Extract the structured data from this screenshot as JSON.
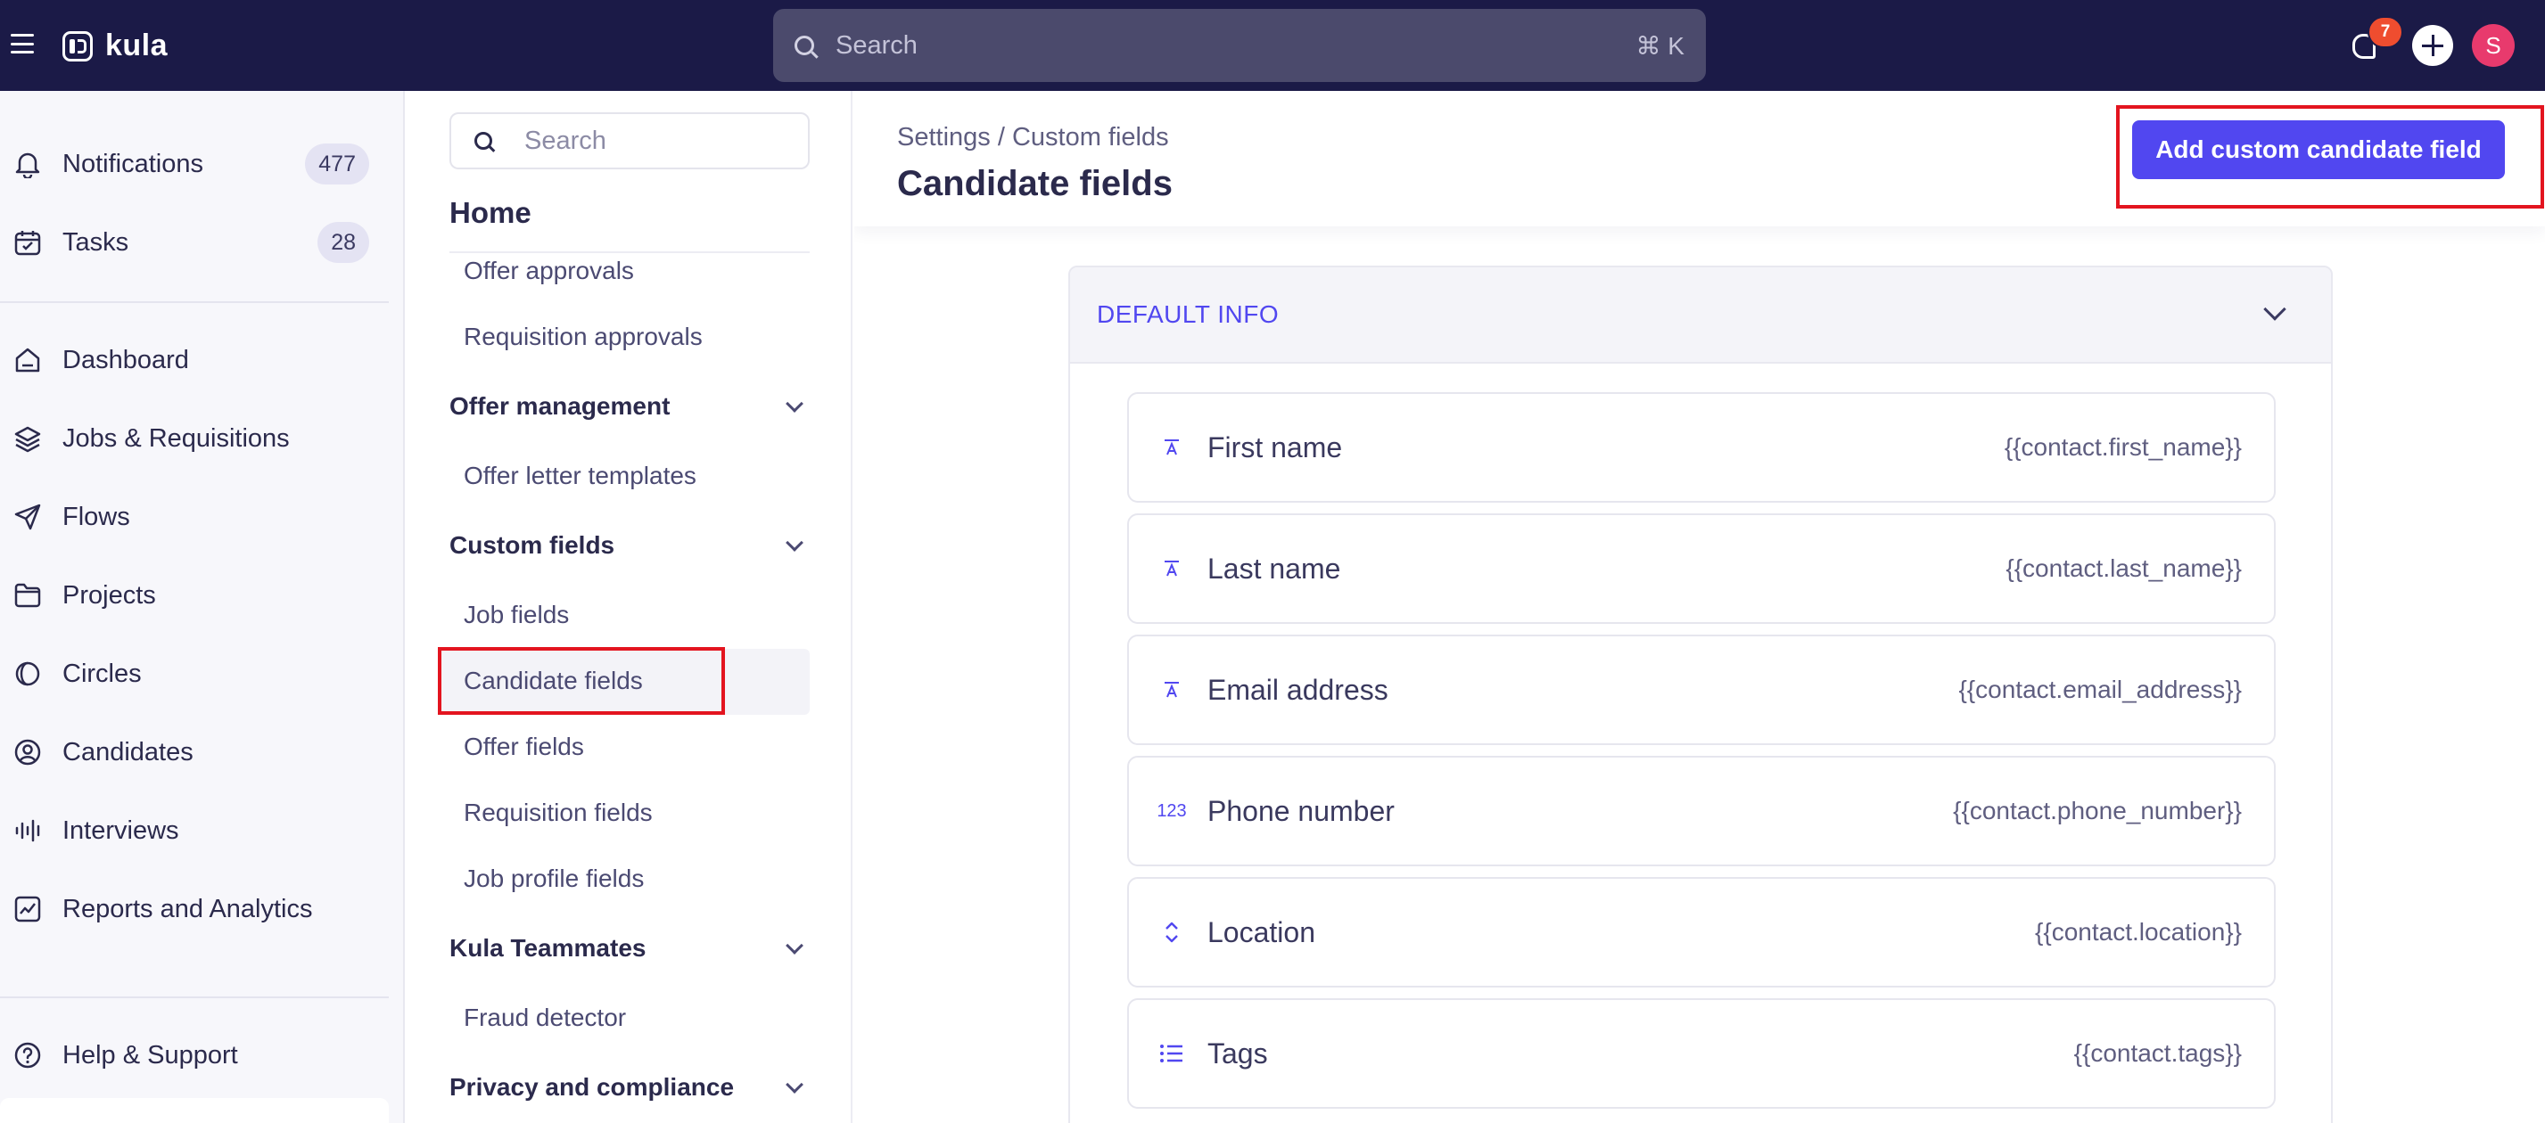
{
  "app": {
    "name": "kula"
  },
  "topbar": {
    "search_placeholder": "Search",
    "search_shortcut": "⌘ K",
    "notification_count": "7",
    "avatar_initial": "S"
  },
  "leftnav": {
    "items": [
      {
        "label": "Notifications",
        "count": "477",
        "icon": "bell-icon"
      },
      {
        "label": "Tasks",
        "count": "28",
        "icon": "calendar-check-icon"
      },
      {
        "label": "Dashboard",
        "icon": "home-icon"
      },
      {
        "label": "Jobs & Requisitions",
        "icon": "layers-icon"
      },
      {
        "label": "Flows",
        "icon": "send-icon"
      },
      {
        "label": "Projects",
        "icon": "folder-icon"
      },
      {
        "label": "Circles",
        "icon": "circle-half-icon"
      },
      {
        "label": "Candidates",
        "icon": "user-circle-icon"
      },
      {
        "label": "Interviews",
        "icon": "audio-wave-icon"
      },
      {
        "label": "Reports and Analytics",
        "icon": "chart-icon"
      },
      {
        "label": "Help & Support",
        "icon": "help-circle-icon"
      }
    ]
  },
  "settings_nav": {
    "search_placeholder": "Search",
    "home": "Home",
    "links_top": [
      "Offer approvals",
      "Requisition approvals"
    ],
    "groups": [
      {
        "label": "Offer management",
        "links": [
          "Offer letter templates"
        ]
      },
      {
        "label": "Custom fields",
        "links": [
          "Job fields",
          "Candidate fields",
          "Offer fields",
          "Requisition fields",
          "Job profile fields"
        ]
      },
      {
        "label": "Kula Teammates",
        "links": [
          "Fraud detector"
        ]
      },
      {
        "label": "Privacy and compliance",
        "links": []
      }
    ],
    "active": "Candidate fields"
  },
  "content": {
    "breadcrumb": "Settings / Custom fields",
    "title": "Candidate fields",
    "add_button": "Add custom candidate field",
    "section": {
      "title": "DEFAULT INFO",
      "fields": [
        {
          "name": "First name",
          "token": "{{contact.first_name}}",
          "icon": "text-field-icon"
        },
        {
          "name": "Last name",
          "token": "{{contact.last_name}}",
          "icon": "text-field-icon"
        },
        {
          "name": "Email address",
          "token": "{{contact.email_address}}",
          "icon": "text-field-icon"
        },
        {
          "name": "Phone number",
          "token": "{{contact.phone_number}}",
          "icon": "number-field-icon",
          "icon_text": "123"
        },
        {
          "name": "Location",
          "token": "{{contact.location}}",
          "icon": "select-field-icon"
        },
        {
          "name": "Tags",
          "token": "{{contact.tags}}",
          "icon": "list-field-icon"
        }
      ]
    }
  },
  "colors": {
    "topbar": "#1b1a47",
    "accent": "#5147f0",
    "highlight": "#e3141f",
    "badge": "#ef4d2f",
    "avatar": "#e83a6d"
  }
}
